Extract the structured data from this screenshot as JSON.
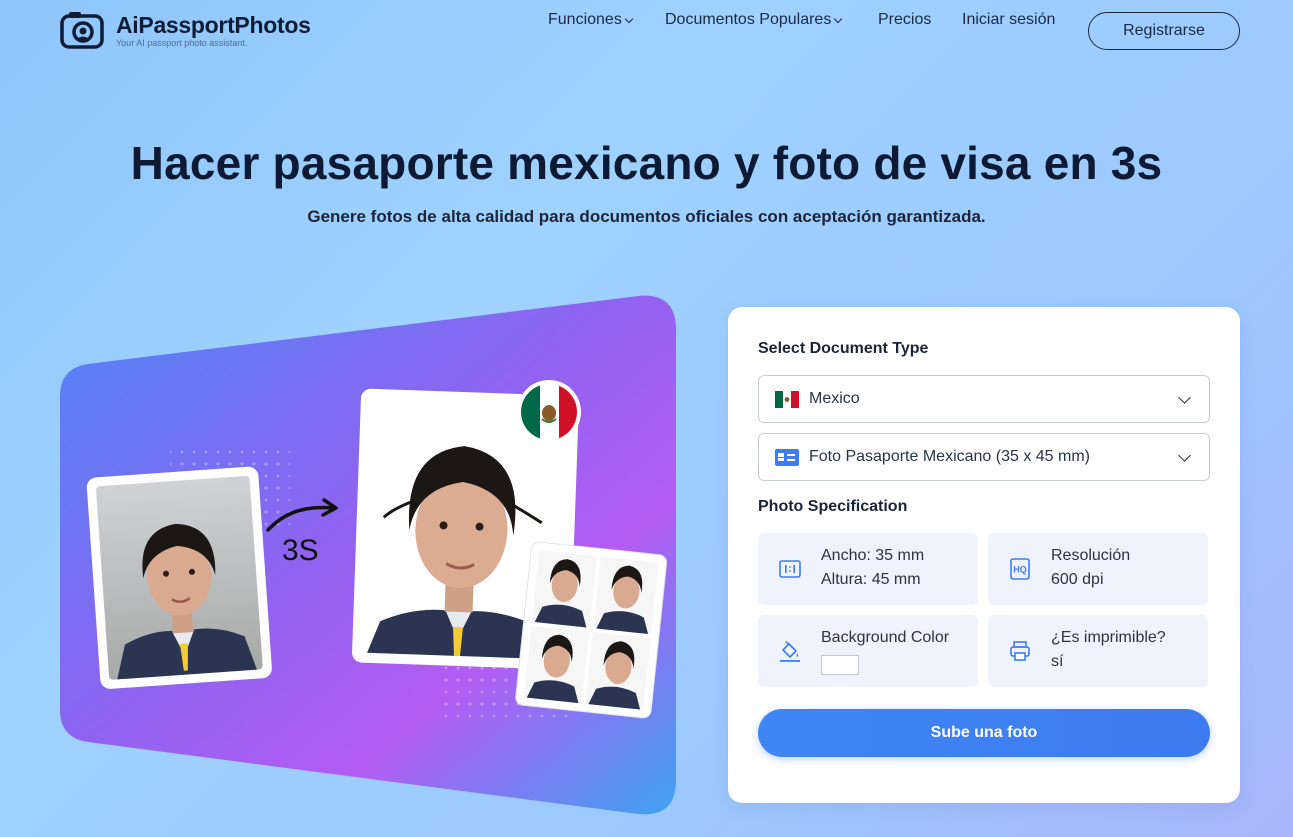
{
  "brand": {
    "name": "AiPassportPhotos",
    "tagline": "Your AI passport photo assistant."
  },
  "nav": {
    "items": [
      {
        "label": "Funciones",
        "has_dropdown": true
      },
      {
        "label": "Documentos Populares",
        "has_dropdown": true
      },
      {
        "label": "Precios",
        "has_dropdown": false
      },
      {
        "label": "Iniciar sesión",
        "has_dropdown": false
      }
    ],
    "register_label": "Registrarse"
  },
  "hero": {
    "title": "Hacer pasaporte mexicano y foto de visa en 3s",
    "subtitle": "Genere fotos de alta calidad para documentos oficiales con aceptación garantizada."
  },
  "illustration": {
    "speed_label": "3S",
    "flag": "mexico-flag-icon"
  },
  "form": {
    "document_type_label": "Select Document Type",
    "country_select": {
      "value": "Mexico",
      "icon": "mexico-flag-icon"
    },
    "document_select": {
      "value": "Foto Pasaporte Mexicano (35 x 45 mm)",
      "icon": "id-card-icon"
    },
    "spec_label": "Photo Specification",
    "specs": {
      "size": {
        "line1": "Ancho: 35 mm",
        "line2": "Altura: 45 mm",
        "icon": "aspect-ratio-icon"
      },
      "resolution": {
        "line1": "Resolución",
        "line2": "600 dpi",
        "icon": "hq-icon"
      },
      "background": {
        "line1": "Background Color",
        "swatch": "#ffffff",
        "icon": "paint-bucket-icon"
      },
      "printable": {
        "line1": "¿Es imprimible?",
        "line2": "sí",
        "icon": "printer-icon"
      }
    },
    "upload_label": "Sube una foto"
  },
  "colors": {
    "accent": "#3f86f5",
    "text_dark": "#0e1a33",
    "card_bg": "#ffffff",
    "spec_bg": "#eef3fd"
  }
}
